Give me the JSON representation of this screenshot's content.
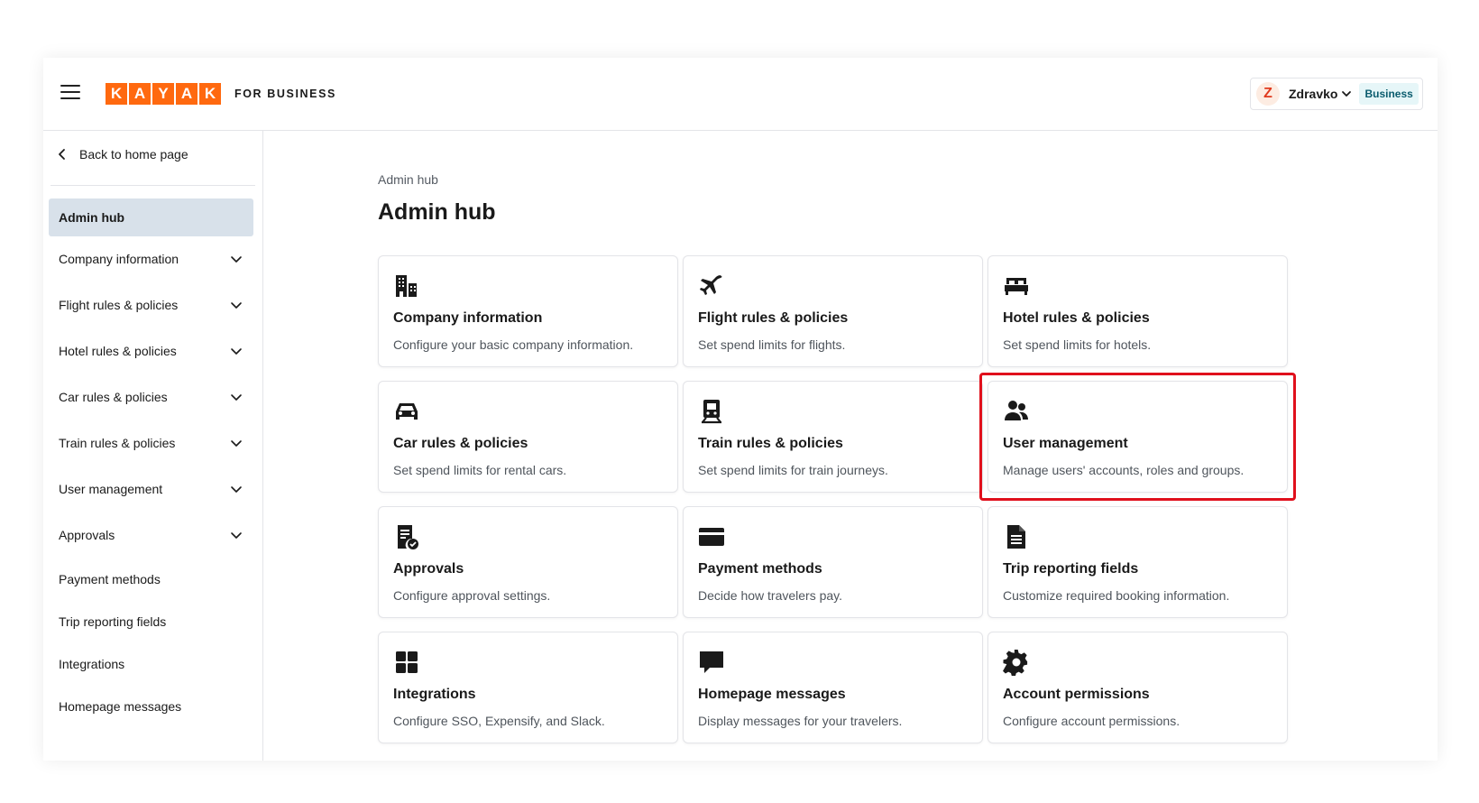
{
  "header": {
    "logo_letters": [
      "K",
      "A",
      "Y",
      "A",
      "K"
    ],
    "logo_suffix": "FOR BUSINESS",
    "user": {
      "initial": "Z",
      "name": "Zdravko",
      "badge": "Business"
    }
  },
  "sidebar": {
    "back_label": "Back to home page",
    "items": [
      {
        "label": "Admin hub",
        "active": true,
        "expandable": false
      },
      {
        "label": "Company information",
        "expandable": true
      },
      {
        "label": "Flight rules & policies",
        "expandable": true
      },
      {
        "label": "Hotel rules & policies",
        "expandable": true
      },
      {
        "label": "Car rules & policies",
        "expandable": true
      },
      {
        "label": "Train rules & policies",
        "expandable": true
      },
      {
        "label": "User management",
        "expandable": true
      },
      {
        "label": "Approvals",
        "expandable": true
      },
      {
        "label": "Payment methods",
        "expandable": false
      },
      {
        "label": "Trip reporting fields",
        "expandable": false
      },
      {
        "label": "Integrations",
        "expandable": false
      },
      {
        "label": "Homepage messages",
        "expandable": false
      }
    ]
  },
  "main": {
    "breadcrumb": "Admin hub",
    "title": "Admin hub",
    "cards": [
      {
        "title": "Company information",
        "desc": "Configure your basic company information.",
        "icon": "building-icon"
      },
      {
        "title": "Flight rules & policies",
        "desc": "Set spend limits for flights.",
        "icon": "airplane-icon"
      },
      {
        "title": "Hotel rules & policies",
        "desc": "Set spend limits for hotels.",
        "icon": "bed-icon"
      },
      {
        "title": "Car rules & policies",
        "desc": "Set spend limits for rental cars.",
        "icon": "car-icon"
      },
      {
        "title": "Train rules & policies",
        "desc": "Set spend limits for train journeys.",
        "icon": "train-icon"
      },
      {
        "title": "User management",
        "desc": "Manage users' accounts, roles and groups.",
        "icon": "users-icon",
        "highlighted": true
      },
      {
        "title": "Approvals",
        "desc": "Configure approval settings.",
        "icon": "document-check-icon"
      },
      {
        "title": "Payment methods",
        "desc": "Decide how travelers pay.",
        "icon": "credit-card-icon"
      },
      {
        "title": "Trip reporting fields",
        "desc": "Customize required booking information.",
        "icon": "document-icon"
      },
      {
        "title": "Integrations",
        "desc": "Configure SSO, Expensify, and Slack.",
        "icon": "grid-icon"
      },
      {
        "title": "Homepage messages",
        "desc": "Display messages for your travelers.",
        "icon": "message-icon"
      },
      {
        "title": "Account permissions",
        "desc": "Configure account permissions.",
        "icon": "gear-icon"
      }
    ]
  },
  "colors": {
    "brand": "#ff690f",
    "active_nav": "#d8e1ea",
    "highlight": "#e0101c",
    "badge_bg": "#e6f6f8"
  }
}
